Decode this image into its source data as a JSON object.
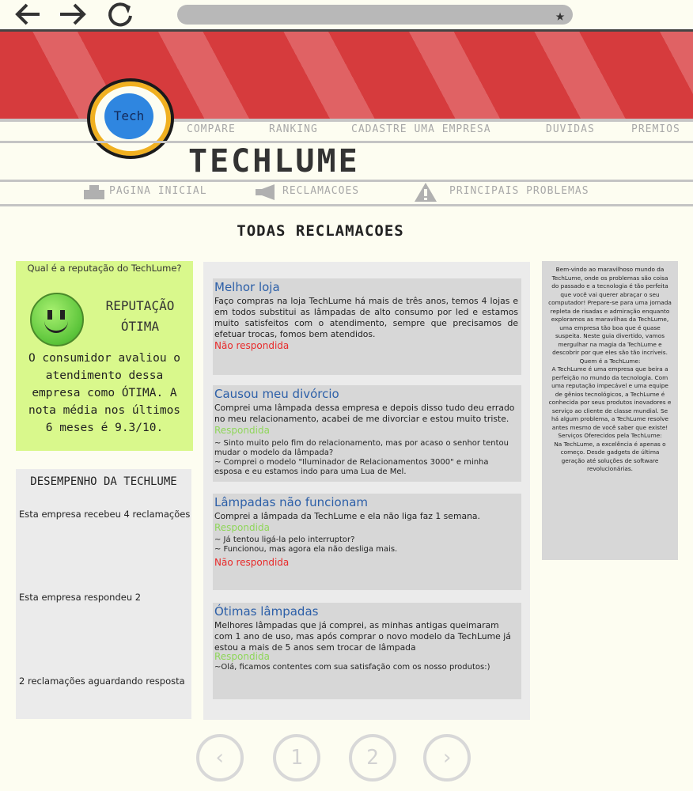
{
  "browser": {
    "back_icon": "arrow-left-icon",
    "forward_icon": "arrow-right-icon",
    "reload_icon": "reload-icon",
    "bookmark_icon": "star-icon",
    "address": ""
  },
  "logo": {
    "text": "Tech"
  },
  "top_nav": [
    "COMPARE",
    "RANKING",
    "CADASTRE UMA EMPRESA",
    "DUVIDAS",
    "PREMIOS"
  ],
  "brand": "TECHLUME",
  "sub_nav": [
    {
      "label": "PAGINA INICIAL",
      "icon": "home-icon"
    },
    {
      "label": "RECLAMACOES",
      "icon": "megaphone-icon"
    },
    {
      "label": "PRINCIPAIS PROBLEMAS",
      "icon": "warning-icon"
    }
  ],
  "page_title": "TODAS RECLAMACOES",
  "reputation": {
    "question": "Qual é a reputação do TechLume?",
    "label_line1": "REPUTAÇÃO",
    "label_line2": "ÓTIMA",
    "text": "O consumidor avaliou o atendimento dessa empresa como ÓTIMA. A nota média nos últimos 6 meses é 9.3/10."
  },
  "performance": {
    "title": "DESEMPENHO DA TECHLUME",
    "received": "Esta empresa recebeu 4 reclamações",
    "answered": "Esta empresa respondeu 2",
    "waiting": "2 reclamações aguardando resposta"
  },
  "complaints": [
    {
      "title": "Melhor loja",
      "body": "Faço compras na loja TechLume há mais de três anos, temos 4 lojas e em todos substitui as lâmpadas de alto consumo por led e estamos muito satisfeitos com o atendimento, sempre que precisamos de efetuar trocas, fomos bem atendidos.",
      "status": "Não respondida"
    },
    {
      "title": "Causou meu divórcio",
      "body": "Comprei uma lâmpada dessa empresa e depois disso tudo deu errado no meu relacionamento, acabei de me divorciar e estou muito triste.",
      "status": "Respondida",
      "reply1": "~ Sinto muito pelo fim do relacionamento, mas por acaso o senhor tentou mudar o modelo da lâmpada?",
      "reply2": "~ Comprei o modelo \"Iluminador de Relacionamentos 3000\" e minha esposa e eu estamos indo para uma Lua de Mel."
    },
    {
      "title": "Lâmpadas não funcionam",
      "body": "Comprei a lâmpada da TechLume e ela não liga faz 1 semana.",
      "status": "Respondida",
      "reply1": "~ Já tentou ligá-la pelo interruptor?",
      "reply2": "~ Funcionou, mas agora ela não desliga mais.",
      "status2": "Não respondida"
    },
    {
      "title": "Ótimas lâmpadas",
      "body": "Melhores lâmpadas que já comprei, as minhas antigas queimaram com 1 ano de uso, mas após comprar o novo modelo da TechLume já estou a mais de 5 anos sem trocar de lâmpada",
      "status": "Respondida",
      "reply1": "~Olá, ficamos contentes com sua satisfação com os nosso produtos:)"
    }
  ],
  "about": "Bem-vindo ao maravilhoso mundo da TechLume, onde os problemas são coisa do passado e a tecnologia é tão perfeita que você vai querer abraçar o seu computador! Prepare-se para uma jornada repleta de risadas e admiração enquanto exploramos as maravilhas da TechLume, uma empresa tão boa que é quase suspeita. Neste guia divertido, vamos mergulhar na magia da TechLume e descobrir por que eles são tão incríveis.\nQuem é a TechLume:\nA TechLume é uma empresa que beira a perfeição no mundo da tecnologia. Com uma reputação impecável e uma equipe de gênios tecnológicos, a TechLume é conhecida por seus produtos inovadores e serviço ao cliente de classe mundial. Se há algum problema, a TechLume resolve antes mesmo de você saber que existe!\nServiços Oferecidos pela TechLume:\nNa TechLume, a excelência é apenas o começo. Desde gadgets de última geração até soluções de software revolucionárias.",
  "pagination": {
    "prev": "‹",
    "pages": [
      "1",
      "2"
    ],
    "next": "›"
  }
}
